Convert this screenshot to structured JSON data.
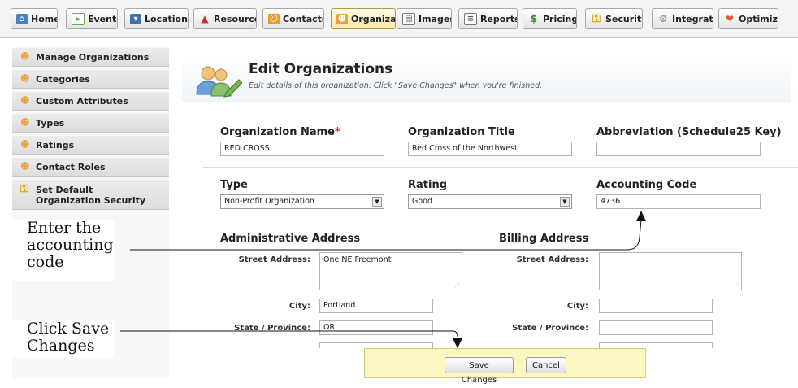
{
  "tabs": [
    {
      "label": "Home",
      "icon": "home-icon"
    },
    {
      "label": "Events",
      "icon": "events-icon"
    },
    {
      "label": "Locations",
      "icon": "locations-icon"
    },
    {
      "label": "Resource",
      "icon": "resource-icon"
    },
    {
      "label": "Contacts",
      "icon": "contacts-icon"
    },
    {
      "label": "Organizat",
      "icon": "organizations-icon",
      "active": true
    },
    {
      "label": "Images",
      "icon": "images-icon"
    },
    {
      "label": "Reports",
      "icon": "reports-icon"
    },
    {
      "label": "Pricing",
      "icon": "pricing-icon"
    },
    {
      "label": "Security",
      "icon": "security-key-icon"
    },
    {
      "label": "Integratic",
      "icon": "integration-icon"
    },
    {
      "label": "Optimizer",
      "icon": "optimizer-icon"
    }
  ],
  "sidebar": {
    "items": [
      {
        "label": "Manage Organizations"
      },
      {
        "label": "Categories"
      },
      {
        "label": "Custom Attributes"
      },
      {
        "label": "Types"
      },
      {
        "label": "Ratings"
      },
      {
        "label": "Contact Roles"
      },
      {
        "label": "Set Default Organization Security"
      }
    ]
  },
  "header": {
    "title": "Edit Organizations",
    "subtitle": "Edit details of this organization. Click \"Save Changes\" when you're finished."
  },
  "form": {
    "org_name": {
      "label": "Organization Name",
      "required_mark": "*",
      "value": "RED CROSS"
    },
    "org_title": {
      "label": "Organization Title",
      "value": "Red Cross of the Northwest"
    },
    "abbreviation": {
      "label": "Abbreviation (Schedule25 Key)",
      "value": ""
    },
    "type": {
      "label": "Type",
      "value": "Non-Profit Organization"
    },
    "rating": {
      "label": "Rating",
      "value": "Good"
    },
    "accounting_code": {
      "label": "Accounting Code",
      "value": "4736"
    }
  },
  "admin_address": {
    "heading": "Administrative Address",
    "street_label": "Street Address:",
    "street_value": "One NE Freemont",
    "city_label": "City:",
    "city_value": "Portland",
    "state_label": "State / Province:",
    "state_value": "OR"
  },
  "billing_address": {
    "heading": "Billing Address",
    "street_label": "Street Address:",
    "street_value": "",
    "city_label": "City:",
    "city_value": "",
    "state_label": "State / Province:",
    "state_value": ""
  },
  "actions": {
    "save_label": "Save Changes",
    "cancel_label": "Cancel"
  },
  "callouts": {
    "accounting": [
      "Enter the",
      "accounting",
      "code"
    ],
    "save": [
      "Click Save",
      "Changes"
    ]
  },
  "colors": {
    "required": "#d42020",
    "save_bar": "#fbf6c2",
    "active_tab": "#ffe7a8"
  }
}
